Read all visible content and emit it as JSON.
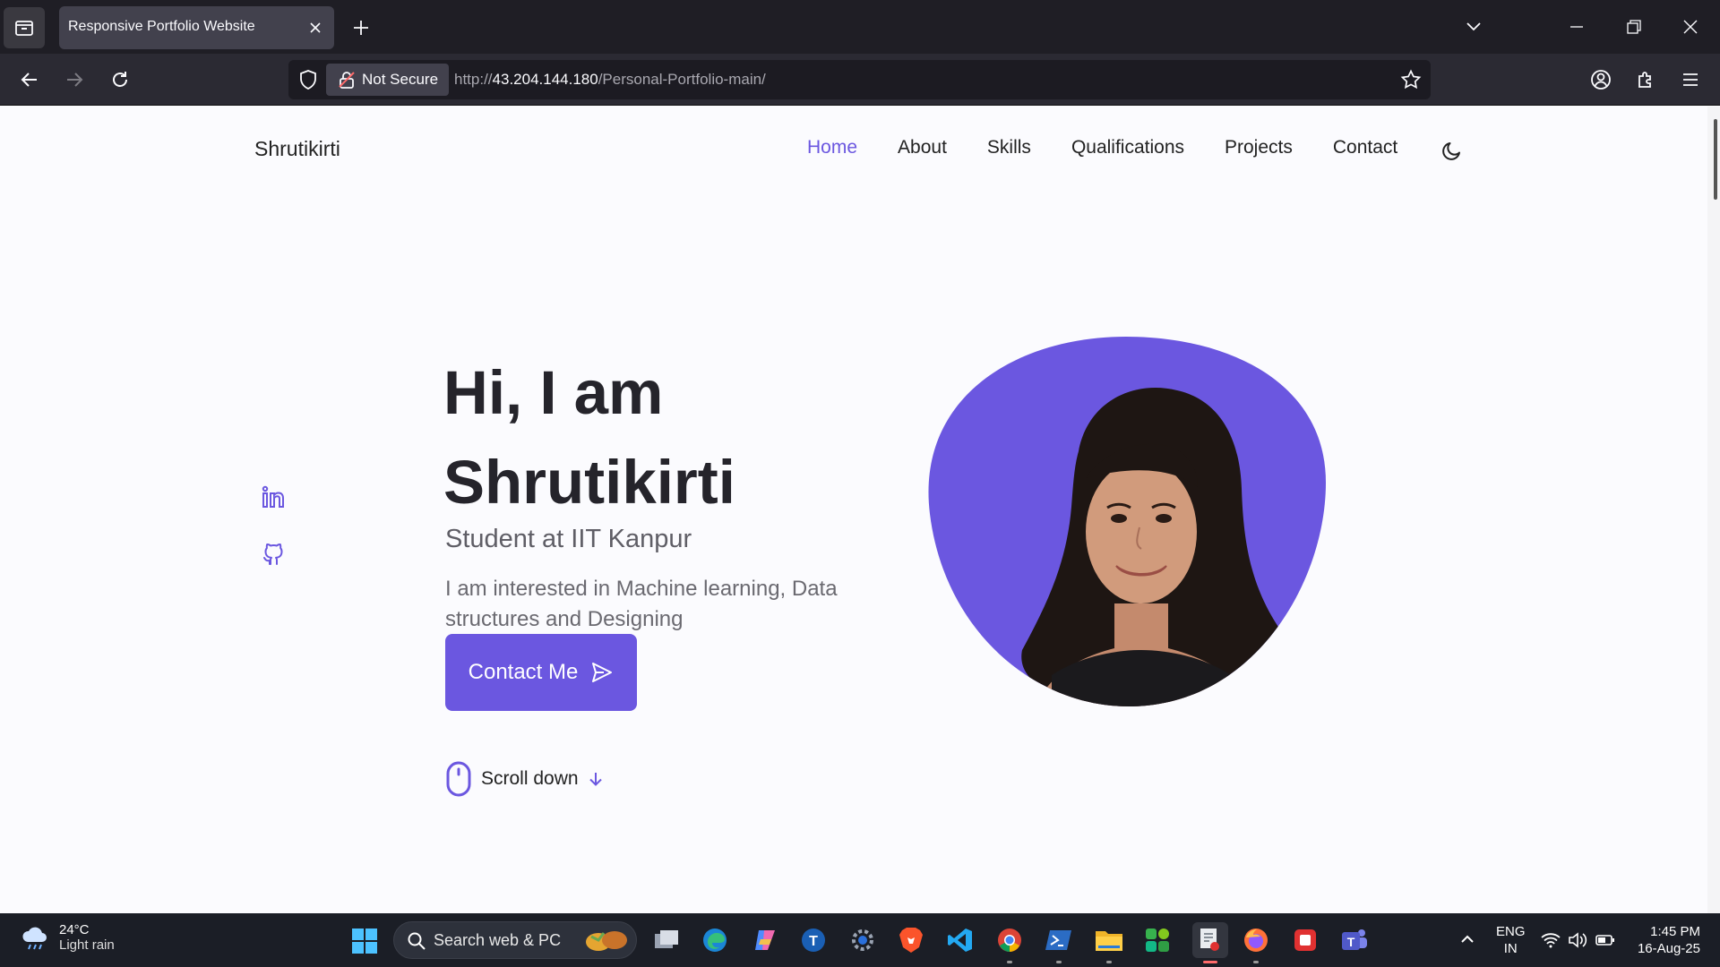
{
  "browser": {
    "tab_title": "Responsive Portfolio Website",
    "not_secure_label": "Not Secure",
    "url_prefix": "http://",
    "url_host": "43.204.144.180",
    "url_path": "/Personal-Portfolio-main/"
  },
  "site": {
    "logo": "Shrutikirti",
    "nav": [
      "Home",
      "About",
      "Skills",
      "Qualifications",
      "Projects",
      "Contact"
    ],
    "active_nav": "Home",
    "hero": {
      "title_line1": "Hi, I am",
      "title_line2": "Shrutikirti",
      "subtitle": "Student at IIT Kanpur",
      "description": "I am interested in Machine learning, Data structures and Designing",
      "cta_label": "Contact Me",
      "scroll_label": "Scroll down"
    },
    "accent_color": "#6b57e0"
  },
  "taskbar": {
    "weather_temp": "24°C",
    "weather_desc": "Light rain",
    "search_placeholder": "Search web & PC",
    "lang_line1": "ENG",
    "lang_line2": "IN",
    "time": "1:45 PM",
    "date": "16-Aug-25"
  }
}
